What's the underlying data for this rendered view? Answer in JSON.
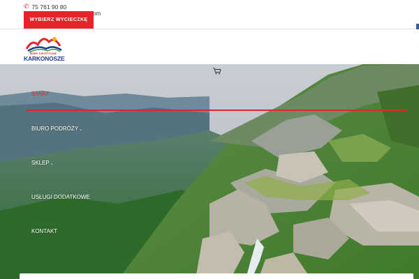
{
  "topbar": {
    "phone": "75 761 90 80",
    "email_fragment": "om",
    "cta_label": "WYBIERZ WYCIECZKĘ"
  },
  "logo": {
    "small_text": "BIURO TURYSTYCZNE",
    "main_text": "KARKONOSZE"
  },
  "nav": {
    "items": [
      {
        "label": "START",
        "active": true
      },
      {
        "label": "BIURO PODRÓŻY",
        "dropdown": true
      },
      {
        "label": "SKLEP",
        "dropdown": true
      },
      {
        "label": "USŁUGI DODATKOWE",
        "dropdown": false
      },
      {
        "label": "KONTAKT",
        "dropdown": false
      }
    ]
  },
  "colors": {
    "accent": "#e5232b",
    "brand_blue": "#1e3f8f"
  },
  "icons": {
    "phone": "phone-icon",
    "cart": "cart-icon",
    "chevron": "chevron-down-icon"
  }
}
